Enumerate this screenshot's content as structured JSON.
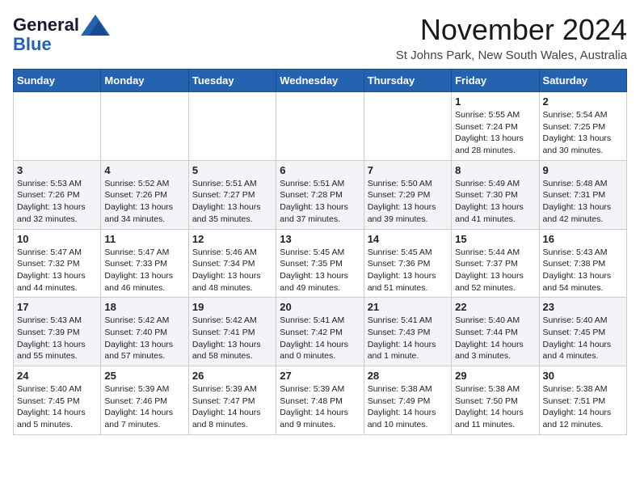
{
  "logo": {
    "general": "General",
    "blue": "Blue"
  },
  "title": "November 2024",
  "location": "St Johns Park, New South Wales, Australia",
  "days_of_week": [
    "Sunday",
    "Monday",
    "Tuesday",
    "Wednesday",
    "Thursday",
    "Friday",
    "Saturday"
  ],
  "weeks": [
    [
      {
        "day": "",
        "info": ""
      },
      {
        "day": "",
        "info": ""
      },
      {
        "day": "",
        "info": ""
      },
      {
        "day": "",
        "info": ""
      },
      {
        "day": "",
        "info": ""
      },
      {
        "day": "1",
        "info": "Sunrise: 5:55 AM\nSunset: 7:24 PM\nDaylight: 13 hours and 28 minutes."
      },
      {
        "day": "2",
        "info": "Sunrise: 5:54 AM\nSunset: 7:25 PM\nDaylight: 13 hours and 30 minutes."
      }
    ],
    [
      {
        "day": "3",
        "info": "Sunrise: 5:53 AM\nSunset: 7:26 PM\nDaylight: 13 hours and 32 minutes."
      },
      {
        "day": "4",
        "info": "Sunrise: 5:52 AM\nSunset: 7:26 PM\nDaylight: 13 hours and 34 minutes."
      },
      {
        "day": "5",
        "info": "Sunrise: 5:51 AM\nSunset: 7:27 PM\nDaylight: 13 hours and 35 minutes."
      },
      {
        "day": "6",
        "info": "Sunrise: 5:51 AM\nSunset: 7:28 PM\nDaylight: 13 hours and 37 minutes."
      },
      {
        "day": "7",
        "info": "Sunrise: 5:50 AM\nSunset: 7:29 PM\nDaylight: 13 hours and 39 minutes."
      },
      {
        "day": "8",
        "info": "Sunrise: 5:49 AM\nSunset: 7:30 PM\nDaylight: 13 hours and 41 minutes."
      },
      {
        "day": "9",
        "info": "Sunrise: 5:48 AM\nSunset: 7:31 PM\nDaylight: 13 hours and 42 minutes."
      }
    ],
    [
      {
        "day": "10",
        "info": "Sunrise: 5:47 AM\nSunset: 7:32 PM\nDaylight: 13 hours and 44 minutes."
      },
      {
        "day": "11",
        "info": "Sunrise: 5:47 AM\nSunset: 7:33 PM\nDaylight: 13 hours and 46 minutes."
      },
      {
        "day": "12",
        "info": "Sunrise: 5:46 AM\nSunset: 7:34 PM\nDaylight: 13 hours and 48 minutes."
      },
      {
        "day": "13",
        "info": "Sunrise: 5:45 AM\nSunset: 7:35 PM\nDaylight: 13 hours and 49 minutes."
      },
      {
        "day": "14",
        "info": "Sunrise: 5:45 AM\nSunset: 7:36 PM\nDaylight: 13 hours and 51 minutes."
      },
      {
        "day": "15",
        "info": "Sunrise: 5:44 AM\nSunset: 7:37 PM\nDaylight: 13 hours and 52 minutes."
      },
      {
        "day": "16",
        "info": "Sunrise: 5:43 AM\nSunset: 7:38 PM\nDaylight: 13 hours and 54 minutes."
      }
    ],
    [
      {
        "day": "17",
        "info": "Sunrise: 5:43 AM\nSunset: 7:39 PM\nDaylight: 13 hours and 55 minutes."
      },
      {
        "day": "18",
        "info": "Sunrise: 5:42 AM\nSunset: 7:40 PM\nDaylight: 13 hours and 57 minutes."
      },
      {
        "day": "19",
        "info": "Sunrise: 5:42 AM\nSunset: 7:41 PM\nDaylight: 13 hours and 58 minutes."
      },
      {
        "day": "20",
        "info": "Sunrise: 5:41 AM\nSunset: 7:42 PM\nDaylight: 14 hours and 0 minutes."
      },
      {
        "day": "21",
        "info": "Sunrise: 5:41 AM\nSunset: 7:43 PM\nDaylight: 14 hours and 1 minute."
      },
      {
        "day": "22",
        "info": "Sunrise: 5:40 AM\nSunset: 7:44 PM\nDaylight: 14 hours and 3 minutes."
      },
      {
        "day": "23",
        "info": "Sunrise: 5:40 AM\nSunset: 7:45 PM\nDaylight: 14 hours and 4 minutes."
      }
    ],
    [
      {
        "day": "24",
        "info": "Sunrise: 5:40 AM\nSunset: 7:45 PM\nDaylight: 14 hours and 5 minutes."
      },
      {
        "day": "25",
        "info": "Sunrise: 5:39 AM\nSunset: 7:46 PM\nDaylight: 14 hours and 7 minutes."
      },
      {
        "day": "26",
        "info": "Sunrise: 5:39 AM\nSunset: 7:47 PM\nDaylight: 14 hours and 8 minutes."
      },
      {
        "day": "27",
        "info": "Sunrise: 5:39 AM\nSunset: 7:48 PM\nDaylight: 14 hours and 9 minutes."
      },
      {
        "day": "28",
        "info": "Sunrise: 5:38 AM\nSunset: 7:49 PM\nDaylight: 14 hours and 10 minutes."
      },
      {
        "day": "29",
        "info": "Sunrise: 5:38 AM\nSunset: 7:50 PM\nDaylight: 14 hours and 11 minutes."
      },
      {
        "day": "30",
        "info": "Sunrise: 5:38 AM\nSunset: 7:51 PM\nDaylight: 14 hours and 12 minutes."
      }
    ]
  ]
}
